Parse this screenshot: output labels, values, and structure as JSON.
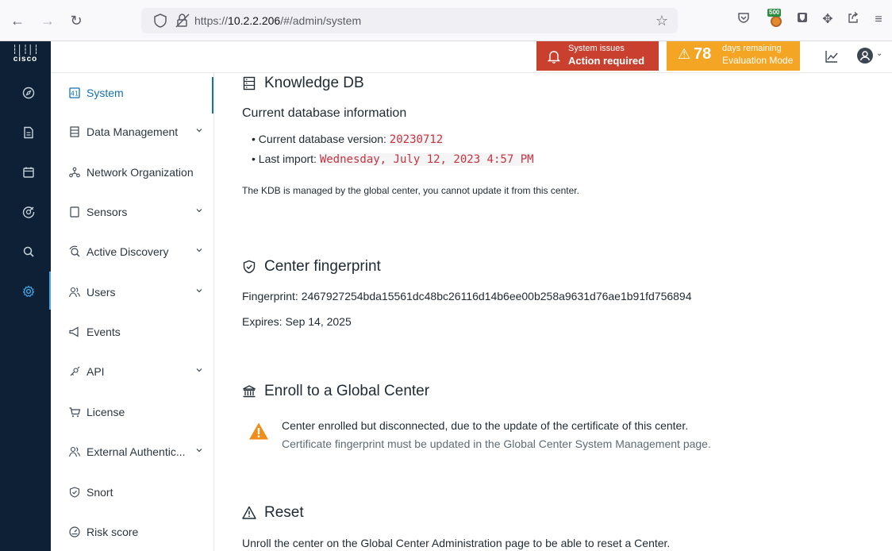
{
  "browser": {
    "url_protocol": "https://",
    "url_host": "10.2.2.206",
    "url_path": "/#/admin/system",
    "ext_badge": "500"
  },
  "brand": {
    "logo_text": "cisco"
  },
  "header": {
    "alert_red": {
      "line1": "System issues",
      "line2": "Action required"
    },
    "alert_orange": {
      "count": "78",
      "line1": "days remaining",
      "line2": "Evaluation Mode"
    }
  },
  "subnav": {
    "items": [
      {
        "label": "System",
        "icon": "system-icon",
        "chevron": false,
        "active": true
      },
      {
        "label": "Data Management",
        "icon": "database-icon",
        "chevron": true
      },
      {
        "label": "Network Organization",
        "icon": "network-icon",
        "chevron": false
      },
      {
        "label": "Sensors",
        "icon": "sensor-icon",
        "chevron": true
      },
      {
        "label": "Active Discovery",
        "icon": "discovery-icon",
        "chevron": true
      },
      {
        "label": "Users",
        "icon": "users-icon",
        "chevron": true
      },
      {
        "label": "Events",
        "icon": "events-icon",
        "chevron": false
      },
      {
        "label": "API",
        "icon": "api-icon",
        "chevron": true
      },
      {
        "label": "License",
        "icon": "license-icon",
        "chevron": false
      },
      {
        "label": "External Authentic...",
        "icon": "external-auth-icon",
        "chevron": true
      },
      {
        "label": "Snort",
        "icon": "snort-icon",
        "chevron": false
      },
      {
        "label": "Risk score",
        "icon": "risk-score-icon",
        "chevron": false
      }
    ]
  },
  "kdb": {
    "title": "Knowledge DB",
    "subtitle": "Current database information",
    "version_label": "Current database version: ",
    "version_value": "20230712",
    "import_label": "Last import: ",
    "import_value": "Wednesday, July 12, 2023 4:57 PM",
    "note": "The KDB is managed by the global center, you cannot update it from this center."
  },
  "fingerprint": {
    "title": "Center fingerprint",
    "fingerprint_text": "Fingerprint: 2467927254bda15561dc48bc26116d14b6ee00b258a9631d76ae1b91fd756894",
    "expires_text": "Expires: Sep 14, 2025"
  },
  "enroll": {
    "title": "Enroll to a Global Center",
    "message": "Center enrolled but disconnected, due to the update of the certificate of this center.",
    "detail": "Certificate fingerprint must be updated in the Global Center System Management page."
  },
  "reset": {
    "title": "Reset",
    "message": "Unroll the center on the Global Center Administration page to be able to reset a Center."
  },
  "colors": {
    "rail_bg": "#0d2035",
    "accent": "#1570b5",
    "alert_red": "#c9402f",
    "alert_orange": "#f4a523",
    "code_red": "#c83241",
    "warning": "#f08c1a"
  }
}
